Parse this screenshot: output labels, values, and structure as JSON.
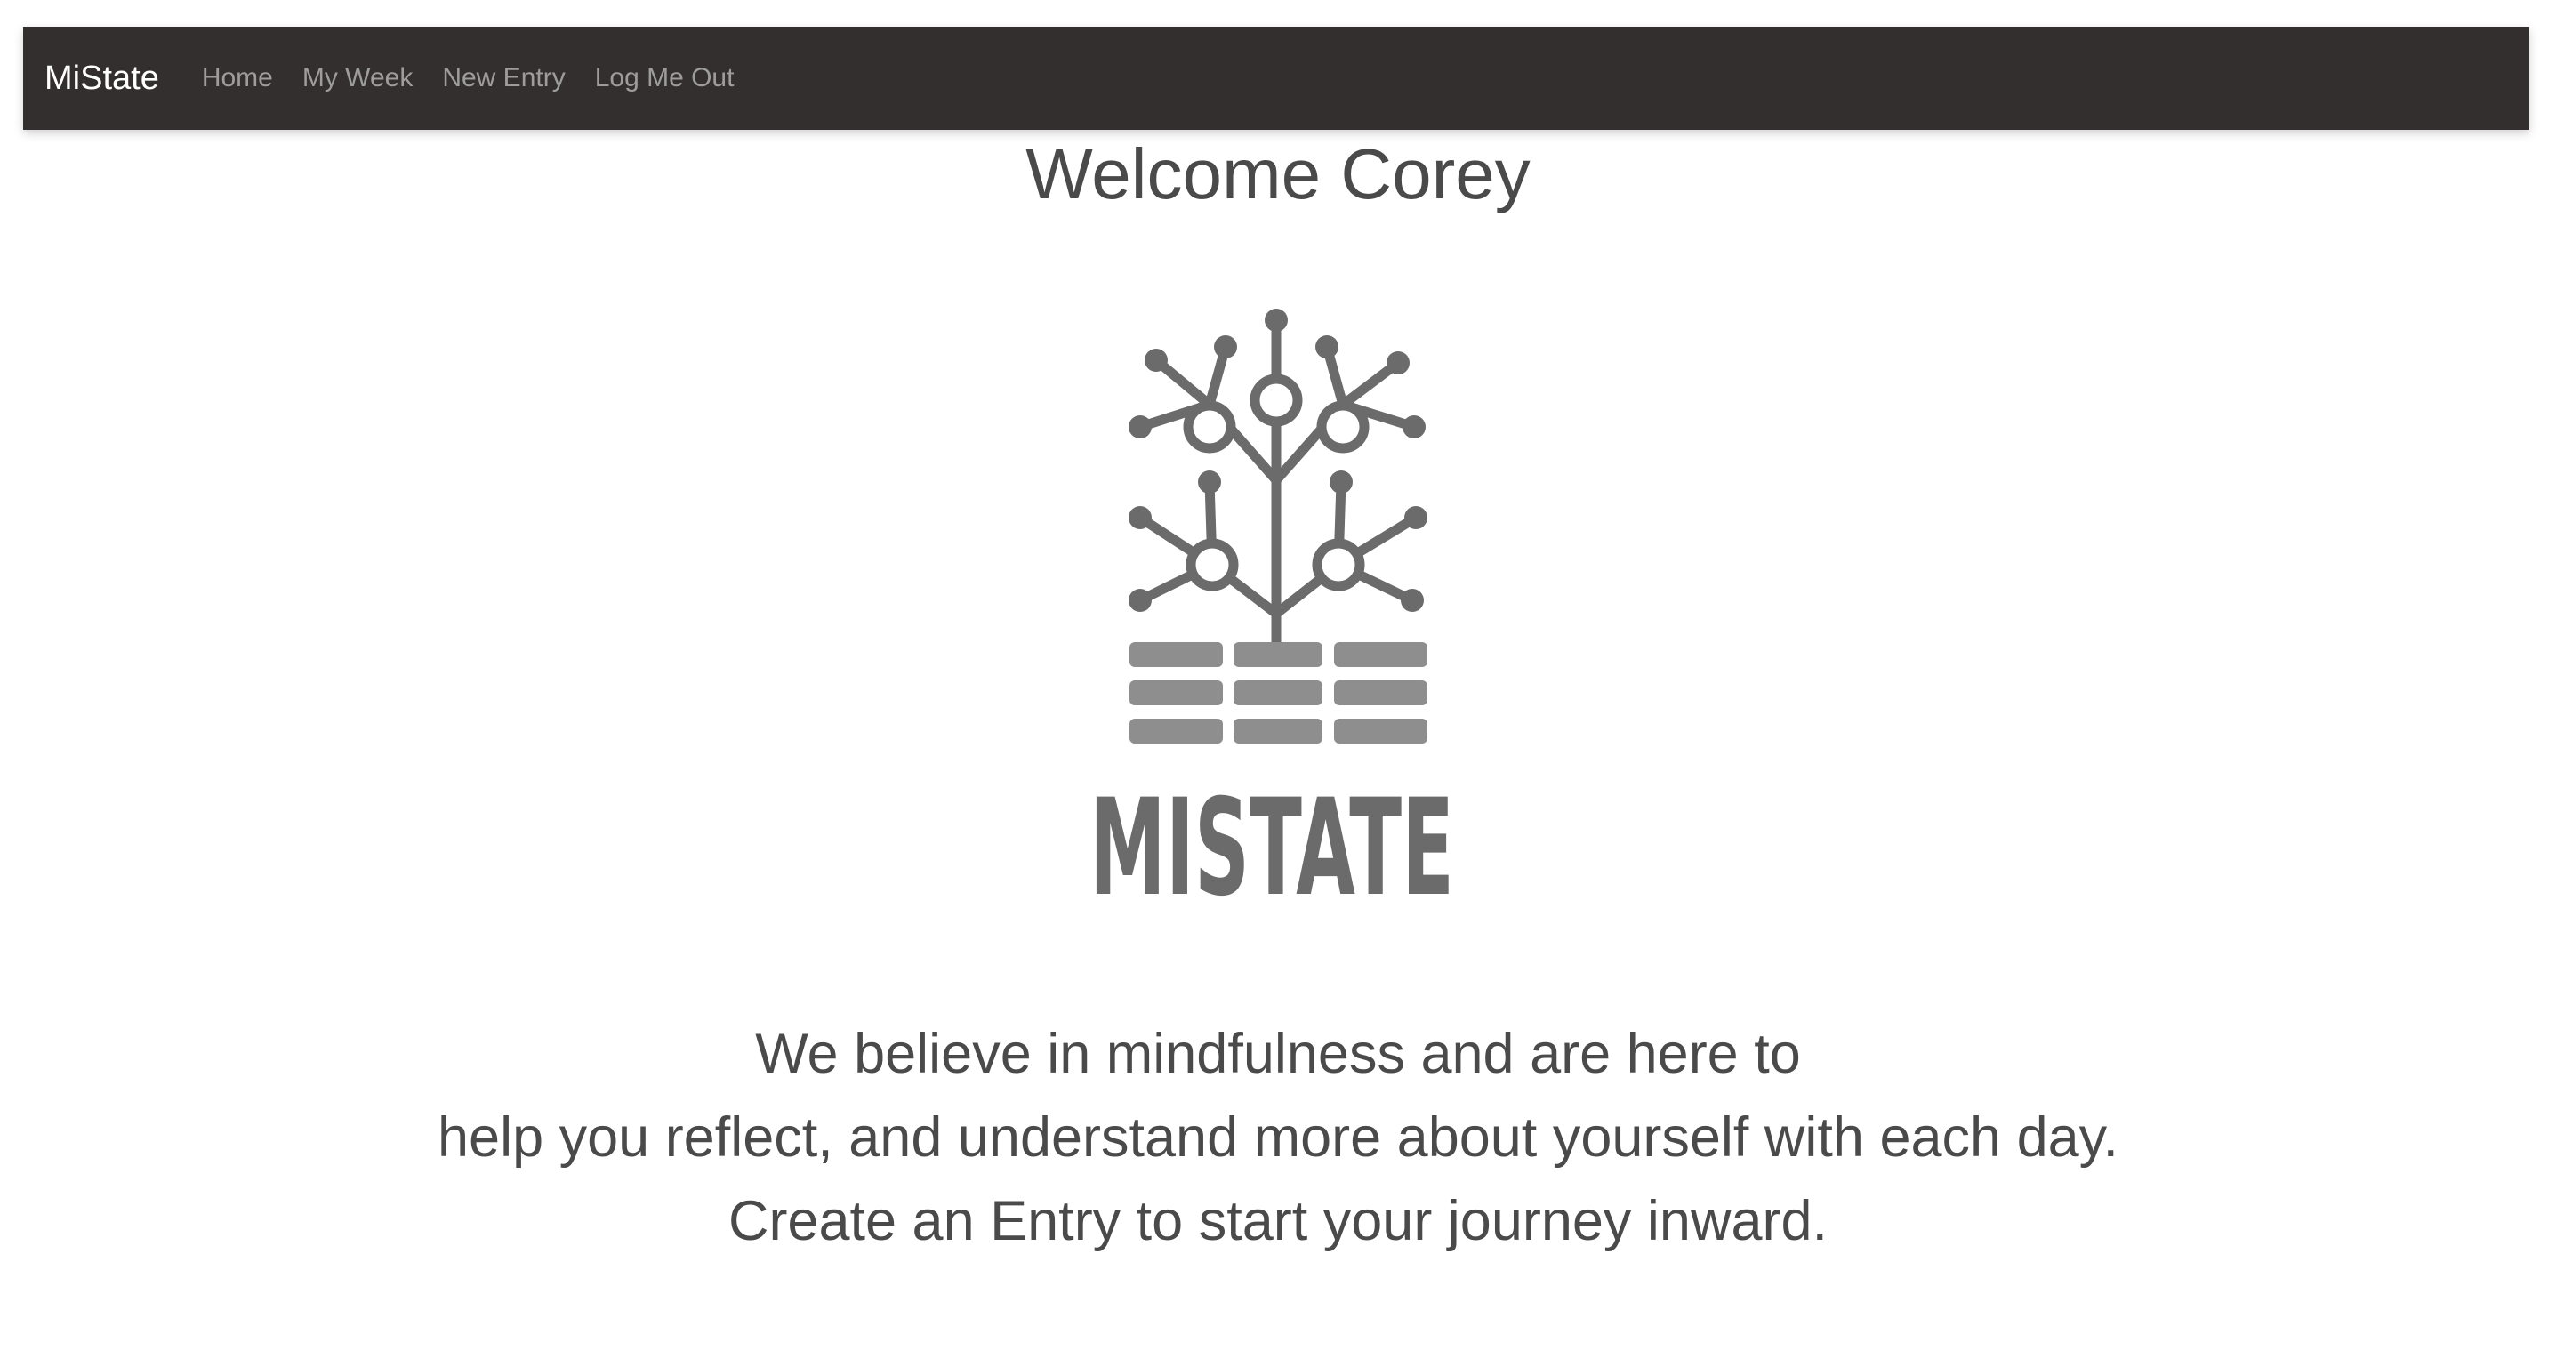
{
  "nav": {
    "brand": "MiState",
    "links": [
      "Home",
      "My Week",
      "New Entry",
      "Log Me Out"
    ]
  },
  "main": {
    "welcome": "Welcome Corey",
    "logo_text": "MISTATE",
    "tagline": [
      "We believe in mindfulness and are here to",
      "help you reflect, and understand more about yourself with each day.",
      "Create an Entry to start your journey inward."
    ]
  },
  "colors": {
    "navbar_bg": "#332f2e",
    "brand_text": "#ffffff",
    "nav_link": "#9d9d9d",
    "body_text": "#4a4a4a",
    "logo_gray": "#6b6b6b"
  },
  "icons": {
    "logo": "tree-circuit-logo"
  }
}
